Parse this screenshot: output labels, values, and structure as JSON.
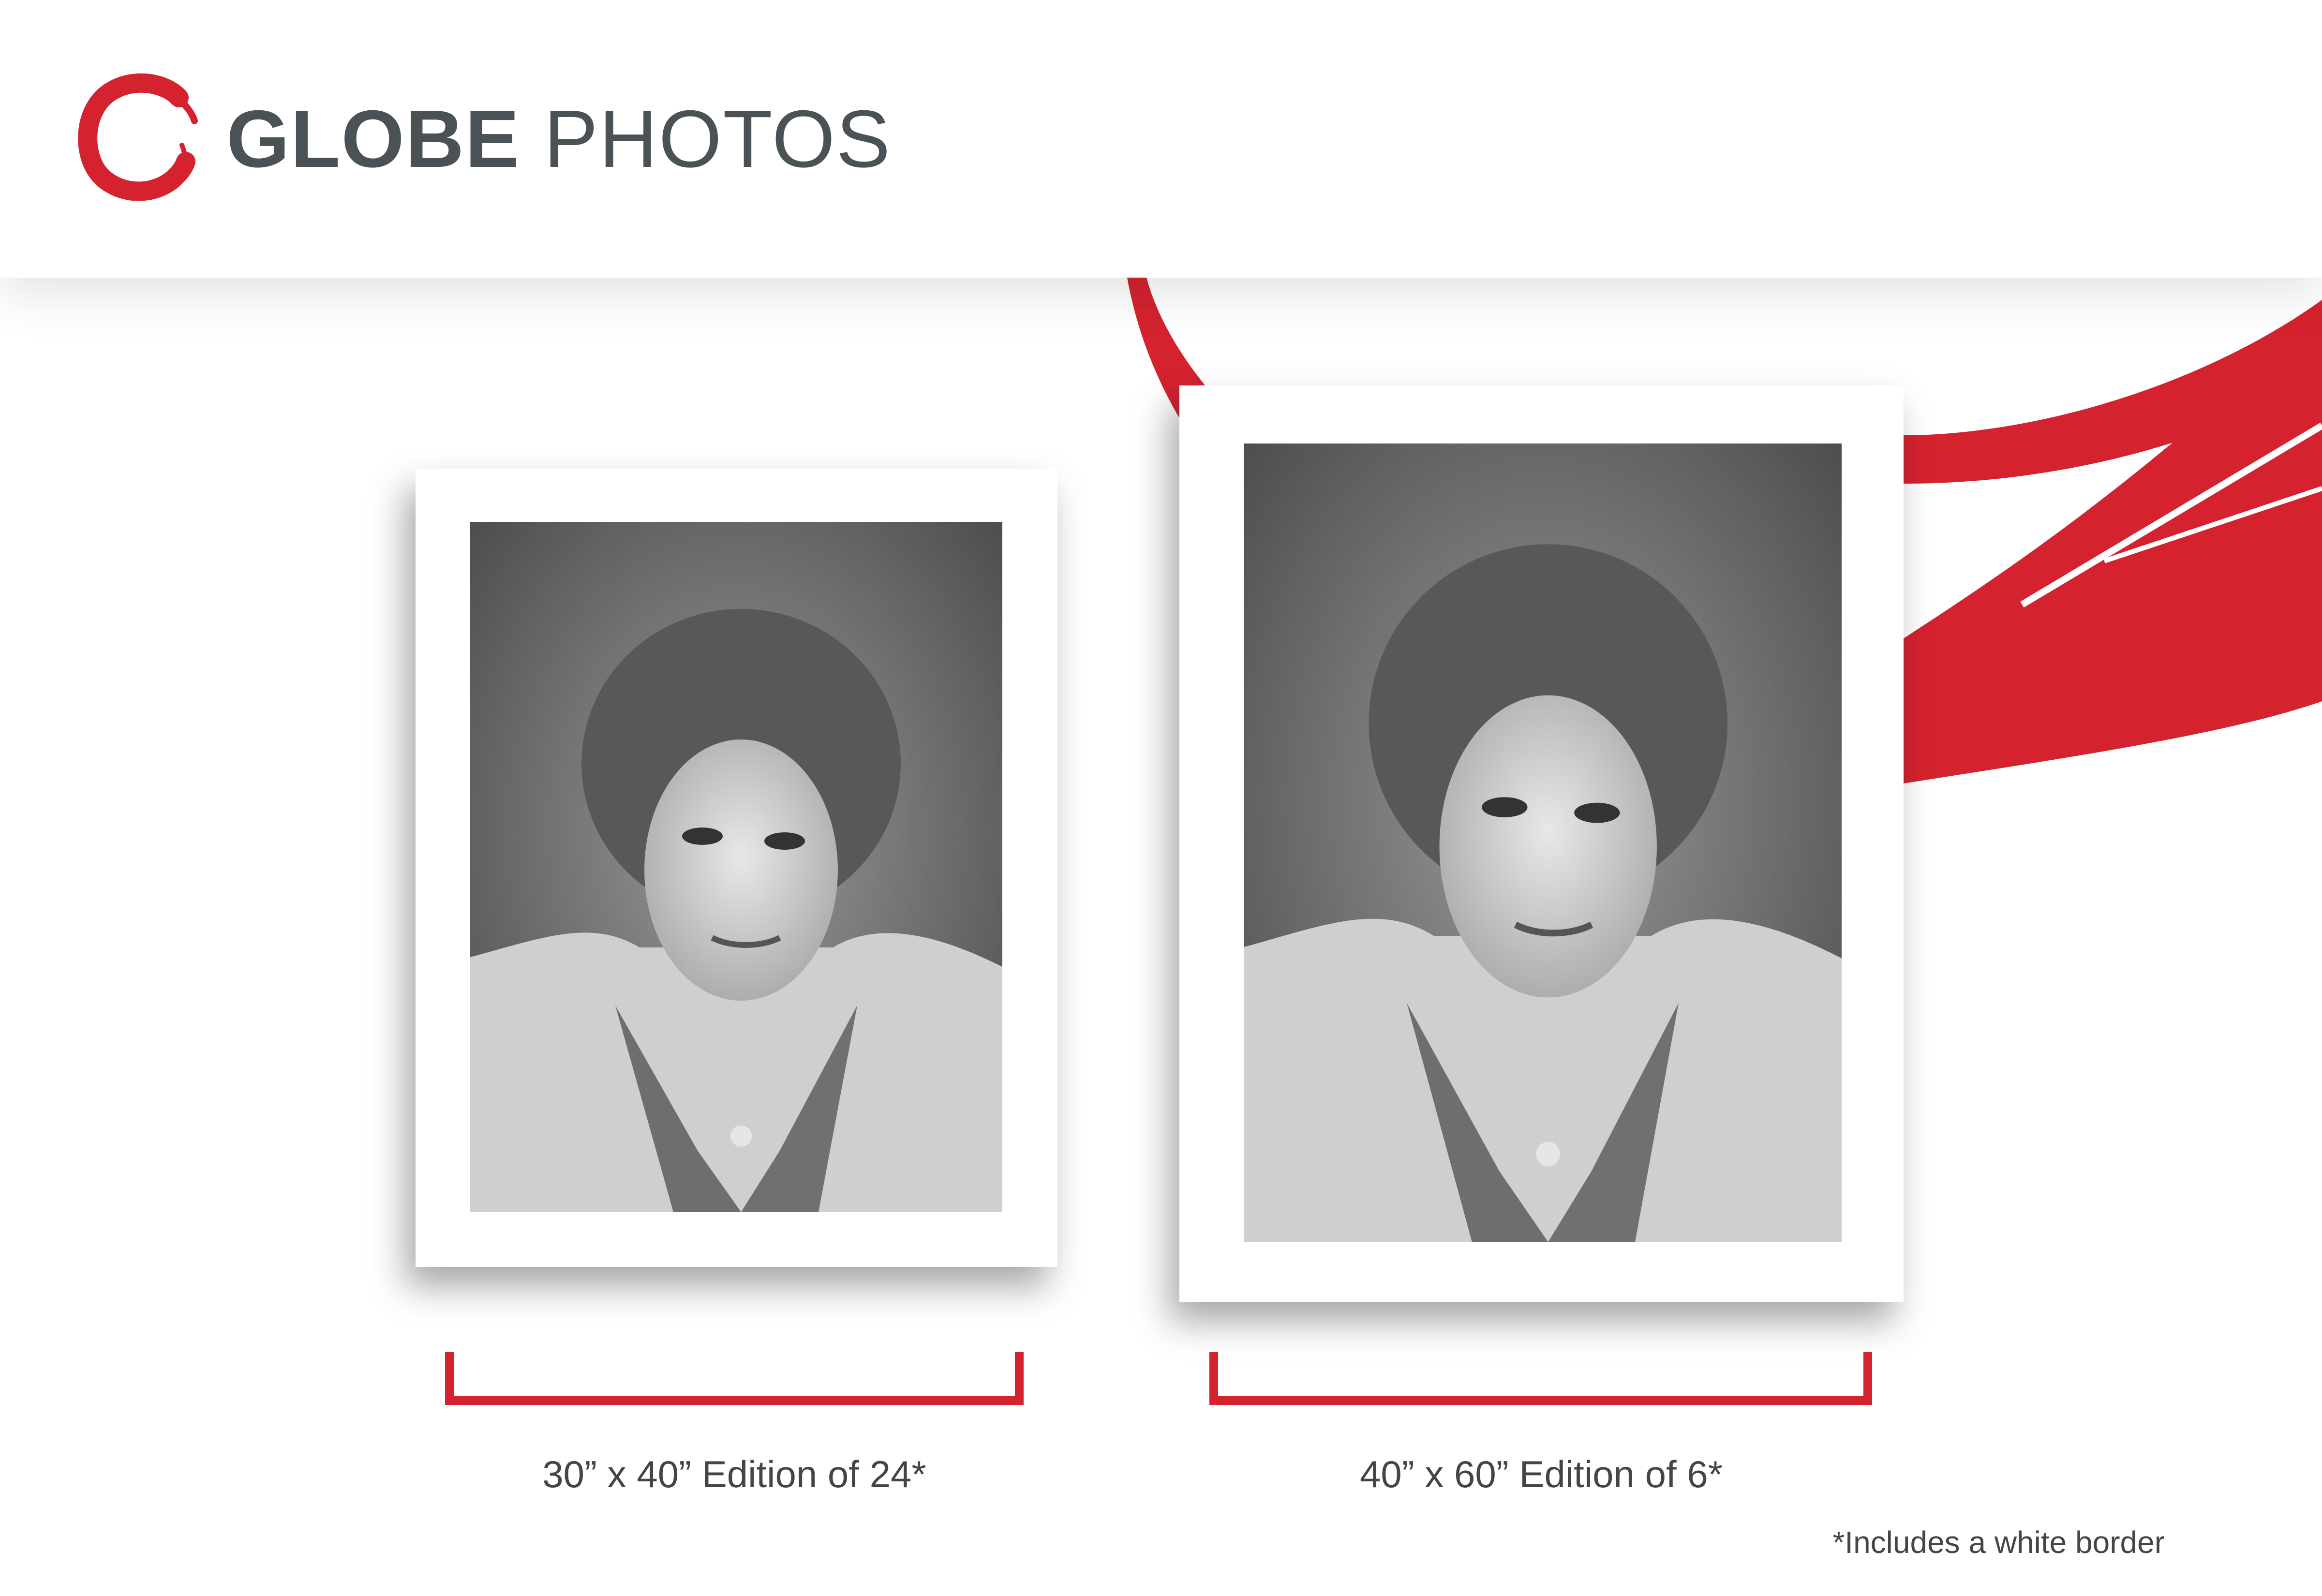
{
  "brand": {
    "name_bold": "GLOBE",
    "name_light": "PHOTOS",
    "logo_icon": "red-brush-circle-icon",
    "accent_color": "#d4232f",
    "text_color": "#4a5256"
  },
  "prints": [
    {
      "caption": "30” x 40” Edition of 24*"
    },
    {
      "caption": "40” x 60” Edition of 6*"
    }
  ],
  "footnote": "*Includes a white border"
}
